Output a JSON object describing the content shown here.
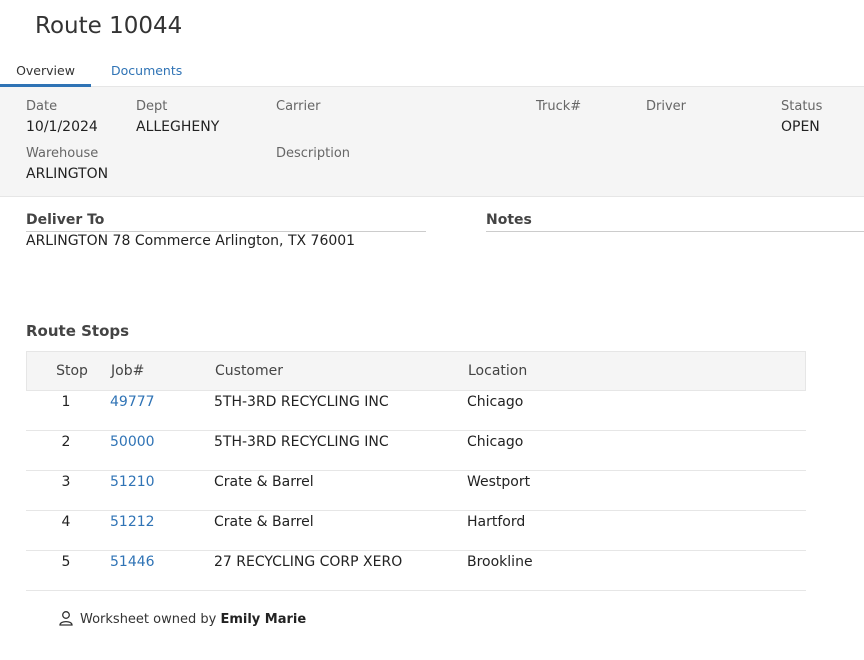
{
  "page": {
    "title": "Route 10044"
  },
  "tabs": [
    {
      "label": "Overview",
      "active": true
    },
    {
      "label": "Documents",
      "active": false
    }
  ],
  "info": {
    "date": {
      "label": "Date",
      "value": "10/1/2024"
    },
    "dept": {
      "label": "Dept",
      "value": "ALLEGHENY"
    },
    "carrier": {
      "label": "Carrier",
      "value": ""
    },
    "truck": {
      "label": "Truck#",
      "value": ""
    },
    "driver": {
      "label": "Driver",
      "value": ""
    },
    "status": {
      "label": "Status",
      "value": "OPEN"
    },
    "warehouse": {
      "label": "Warehouse",
      "value": "ARLINGTON"
    },
    "description": {
      "label": "Description",
      "value": ""
    }
  },
  "deliver_to": {
    "label": "Deliver To",
    "value": "ARLINGTON 78 Commerce Arlington, TX 76001"
  },
  "notes": {
    "label": "Notes",
    "value": ""
  },
  "route_stops": {
    "title": "Route Stops",
    "columns": {
      "stop": "Stop",
      "job": "Job#",
      "customer": "Customer",
      "location": "Location"
    },
    "rows": [
      {
        "stop": "1",
        "job": "49777",
        "customer": "5TH-3RD RECYCLING INC",
        "location": "Chicago"
      },
      {
        "stop": "2",
        "job": "50000",
        "customer": "5TH-3RD RECYCLING INC",
        "location": "Chicago"
      },
      {
        "stop": "3",
        "job": "51210",
        "customer": "Crate & Barrel",
        "location": "Westport"
      },
      {
        "stop": "4",
        "job": "51212",
        "customer": "Crate & Barrel",
        "location": "Hartford"
      },
      {
        "stop": "5",
        "job": "51446",
        "customer": "27 RECYCLING CORP XERO",
        "location": "Brookline"
      }
    ]
  },
  "footer": {
    "owner_prefix": "Worksheet owned by",
    "owner_name": "Emily Marie",
    "icon": "user-icon"
  },
  "colors": {
    "accent": "#2f73b5",
    "panel_bg": "#f5f5f5",
    "border": "#e6e6e6"
  }
}
